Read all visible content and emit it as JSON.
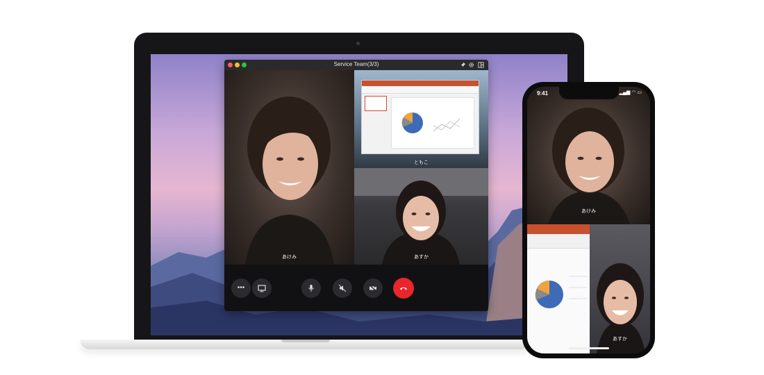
{
  "window": {
    "title": "Service Team(3/3)",
    "traffic_lights": [
      "#ff5f57",
      "#febc2e",
      "#28c840"
    ],
    "toolbar_icons": [
      "pin-icon",
      "gear-icon",
      "layout-icon"
    ]
  },
  "participants": {
    "main": "あけみ",
    "share": "ともこ",
    "third": "あすか"
  },
  "controls": {
    "icons": [
      "more-icon",
      "screen-share-icon",
      "microphone-icon",
      "speaker-mute-icon",
      "camera-icon",
      "hang-up-icon"
    ],
    "end_color": "#e8262b"
  },
  "phone": {
    "time": "9:41",
    "status": "▂▄▆ ◠ ▭",
    "main_label": "あけみ",
    "pip_label": "あすか"
  }
}
